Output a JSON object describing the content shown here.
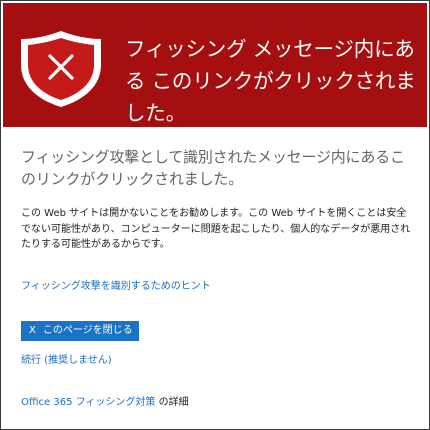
{
  "banner": {
    "title": "フィッシング メッセージ内にある このリンクがクリックされました。",
    "icon": "shield-x-icon",
    "color": "#a50f0f"
  },
  "main": {
    "subheading": "フィッシング攻撃として識別されたメッセージ内にあるこのリンクがクリックされました。",
    "description": "この Web サイトは開かないことをお勧めします。この Web サイトを開くことは安全でない可能性があり、コンピューターに問題を起こしたり、個人的なデータが悪用されたりする可能性があるからです。",
    "hint_link": "フィッシング攻撃を識別するためのヒント",
    "close_button": {
      "icon_glyph": "X",
      "label": "このページを閉じる",
      "color": "#1b73c8"
    },
    "continue_link": "続行 (推奨しません)",
    "footer": {
      "link": "Office 365 フィッシング対策",
      "suffix": " の詳細"
    }
  },
  "link_color": "#1a6fc4"
}
